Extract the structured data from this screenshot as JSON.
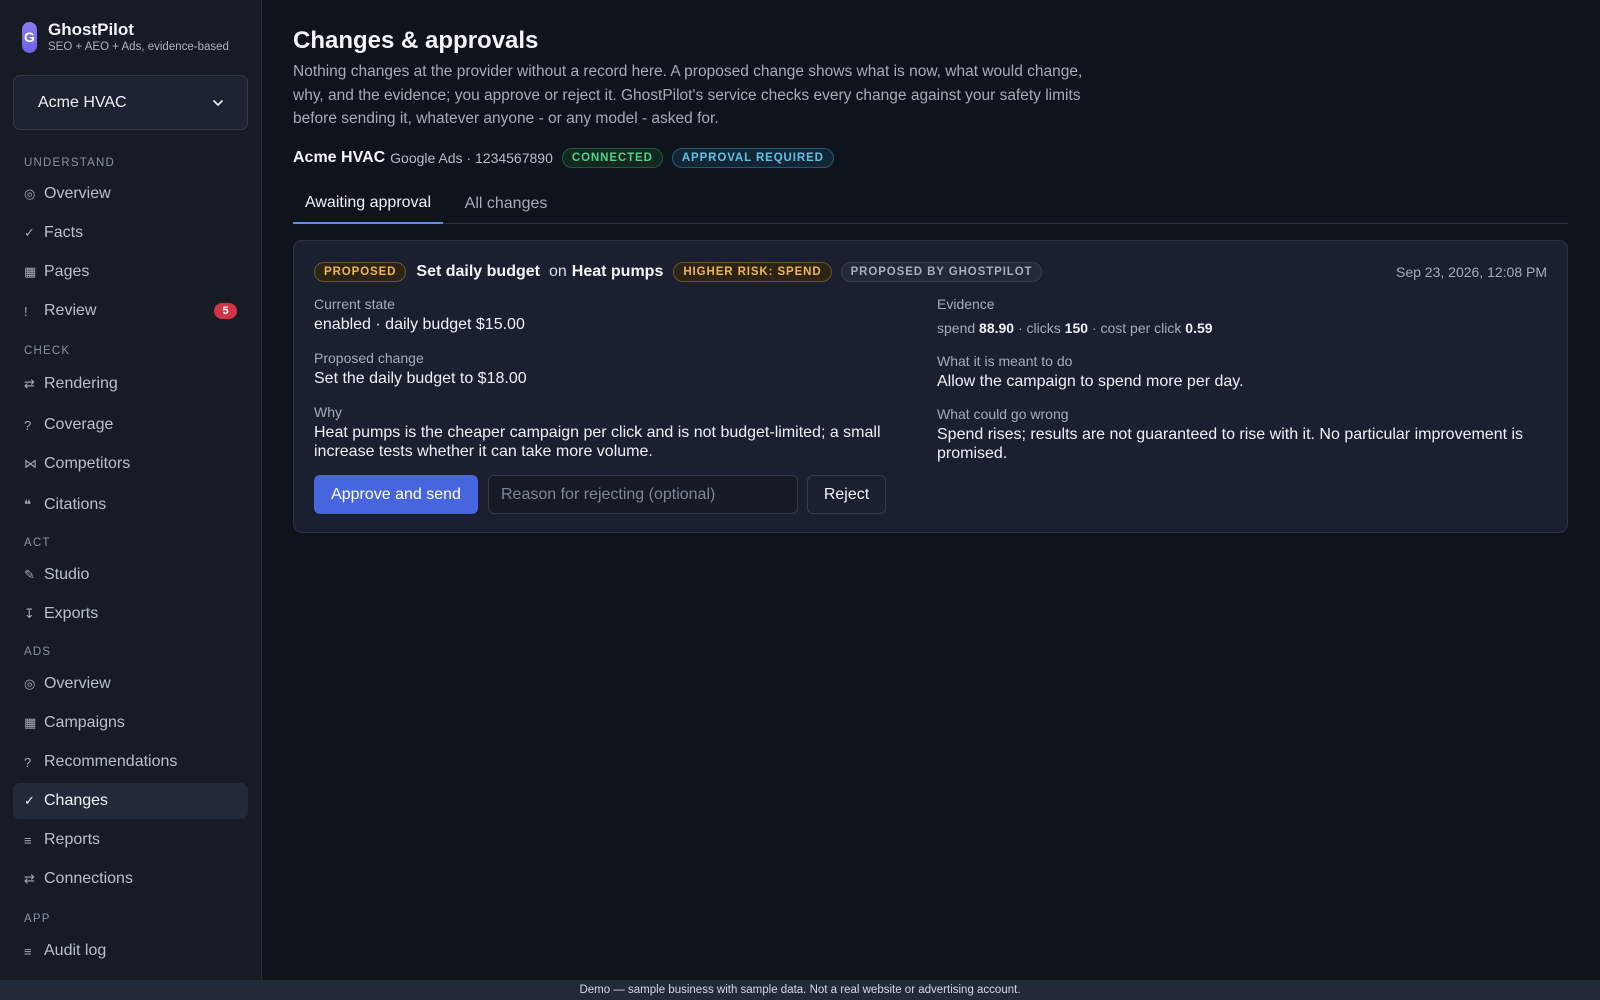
{
  "brand": {
    "name": "GhostPilot",
    "tagline": "SEO + AEO + Ads, evidence-based",
    "logo_letter": "G"
  },
  "account_select": {
    "value": "Acme HVAC"
  },
  "sidebar": {
    "sections": {
      "understand": "UNDERSTAND",
      "check": "CHECK",
      "act": "ACT",
      "ads": "ADS",
      "app": "APP"
    },
    "items": [
      {
        "label": "Overview",
        "icon": "circle-icon",
        "glyph": "◎"
      },
      {
        "label": "Facts",
        "icon": "check-icon",
        "glyph": "✓"
      },
      {
        "label": "Pages",
        "icon": "square-icon",
        "glyph": "▦"
      },
      {
        "label": "Review",
        "icon": "exclamation-icon",
        "glyph": "!",
        "badge": "5"
      },
      {
        "label": "Rendering",
        "icon": "swap-icon",
        "glyph": "⇄"
      },
      {
        "label": "Coverage",
        "icon": "question-icon",
        "glyph": "?"
      },
      {
        "label": "Competitors",
        "icon": "bowtie-icon",
        "glyph": "⋈"
      },
      {
        "label": "Citations",
        "icon": "quote-icon",
        "glyph": "❝"
      },
      {
        "label": "Studio",
        "icon": "pencil-icon",
        "glyph": "✎"
      },
      {
        "label": "Exports",
        "icon": "export-icon",
        "glyph": "↧"
      },
      {
        "label": "Overview",
        "icon": "circle-icon",
        "glyph": "◎"
      },
      {
        "label": "Campaigns",
        "icon": "square-icon",
        "glyph": "▦"
      },
      {
        "label": "Recommendations",
        "icon": "question-icon",
        "glyph": "?"
      },
      {
        "label": "Changes",
        "icon": "check-icon",
        "glyph": "✓"
      },
      {
        "label": "Reports",
        "icon": "lines-icon",
        "glyph": "≡"
      },
      {
        "label": "Connections",
        "icon": "swap-icon",
        "glyph": "⇄"
      },
      {
        "label": "Audit log",
        "icon": "lines-icon",
        "glyph": "≡"
      }
    ]
  },
  "header": {
    "title": "Changes & approvals",
    "description": "Nothing changes at the provider without a record here. A proposed change shows what is now, what would change, why, and the evidence; you approve or reject it. GhostPilot's service checks every change against your safety limits before sending it, whatever anyone - or any model - asked for.",
    "account_name": "Acme HVAC",
    "account_meta": "Google Ads · 1234567890",
    "status_connected": "CONNECTED",
    "status_approval": "APPROVAL REQUIRED"
  },
  "tabs": [
    {
      "label": "Awaiting approval",
      "active": true
    },
    {
      "label": "All changes",
      "active": false
    }
  ],
  "change": {
    "status": "PROPOSED",
    "title": "Set daily budget",
    "on_word": "on",
    "target": "Heat pumps",
    "risk": "HIGHER RISK: SPEND",
    "proposer": "PROPOSED BY GHOSTPILOT",
    "date": "Sep 23, 2026, 12:08 PM",
    "current_state_label": "Current state",
    "current_state": "enabled · daily budget $15.00",
    "proposed_label": "Proposed change",
    "proposed": "Set the daily budget to $18.00",
    "why_label": "Why",
    "why": "Heat pumps is the cheaper campaign per click and is not budget-limited; a small increase tests whether it can take more volume.",
    "evidence_label": "Evidence",
    "evidence": {
      "spend_label": "spend",
      "spend": "88.90",
      "sep": "·",
      "clicks_label": "clicks",
      "clicks": "150",
      "cpc_label": "cost per click",
      "cpc": "0.59"
    },
    "intent_label": "What it is meant to do",
    "intent": "Allow the campaign to spend more per day.",
    "risk_label": "What could go wrong",
    "risk_text": "Spend rises; results are not guaranteed to rise with it. No particular improvement is promised.",
    "approve_label": "Approve and send",
    "reason_placeholder": "Reason for rejecting (optional)",
    "reject_label": "Reject"
  },
  "footer": {
    "text": "Demo — sample business with sample data. Not a real website or advertising account."
  },
  "colors": {
    "accent": "#4865e0",
    "connected": "#4fd18b",
    "approval": "#5ec2ea",
    "proposed": "#f0b550",
    "badge": "#d23547"
  }
}
